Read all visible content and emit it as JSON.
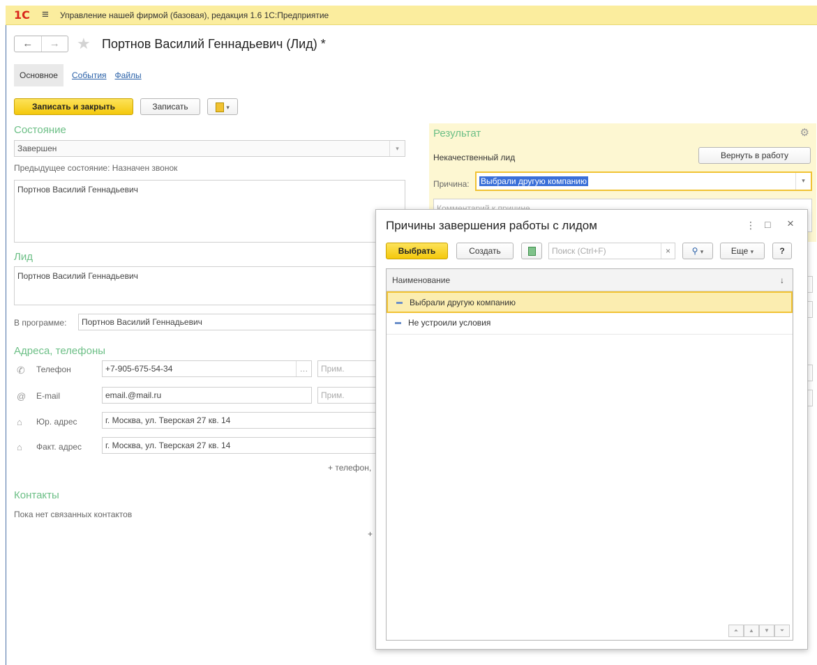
{
  "app": {
    "logo": "1С",
    "title": "Управление нашей фирмой (базовая), редакция 1.6 1С:Предприятие"
  },
  "header": {
    "title": "Портнов Василий Геннадьевич (Лид) *"
  },
  "tabs": [
    {
      "label": "Основное"
    },
    {
      "label": "События"
    },
    {
      "label": "Файлы"
    }
  ],
  "toolbar": {
    "save_close_label": "Записать и закрыть",
    "save_label": "Записать"
  },
  "state": {
    "section_title": "Состояние",
    "value": "Завершен",
    "previous": "Предыдущее состояние: Назначен звонок",
    "note": "Портнов Василий Геннадьевич"
  },
  "lead": {
    "section_title": "Лид",
    "note": "Портнов Василий Геннадьевич",
    "program_label": "В программе:",
    "program_value": "Портнов Василий Геннадьевич"
  },
  "addresses": {
    "section_title": "Адреса, телефоны",
    "rows": [
      {
        "label": "Телефон",
        "value": "+7-905-675-54-34",
        "note_placeholder": "Прим."
      },
      {
        "label": "E-mail",
        "value": "email.@mail.ru",
        "note_placeholder": "Прим."
      },
      {
        "label": "Юр. адрес",
        "value": "г. Москва, ул. Тверская 27 кв. 14"
      },
      {
        "label": "Факт. адрес",
        "value": "г. Москва, ул. Тверская 27 кв. 14"
      }
    ],
    "add_link": "+ телефон,"
  },
  "contacts": {
    "section_title": "Контакты",
    "empty_text": "Пока нет связанных контактов",
    "add_link": "+"
  },
  "result": {
    "section_title": "Результат",
    "status_text": "Некачественный лид",
    "return_button": "Вернуть в работу",
    "reason_label": "Причина:",
    "reason_value": "Выбрали другую компанию",
    "comment_placeholder": "Комментарий к причине"
  },
  "dialog": {
    "title": "Причины завершения работы с лидом",
    "select_button": "Выбрать",
    "create_button": "Создать",
    "search_placeholder": "Поиск (Ctrl+F)",
    "more_button": "Еще",
    "help_button": "?",
    "column_header": "Наименование",
    "rows": [
      {
        "label": "Выбрали другую компанию",
        "selected": true
      },
      {
        "label": "Не устроили условия",
        "selected": false
      }
    ]
  },
  "colors": {
    "accent_yellow": "#f4c80c",
    "section_green": "#6cbf86",
    "link_blue": "#2a61a8",
    "appbar": "#fbed9e"
  }
}
